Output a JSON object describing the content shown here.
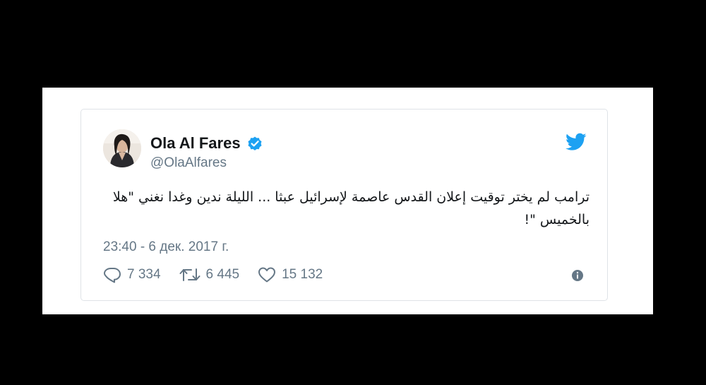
{
  "tweet": {
    "display_name": "Ola Al Fares",
    "handle": "@OlaAlfares",
    "text": "ترامب لم يختر توقيت إعلان القدس عاصمة لإسرائيل عبثا ... الليلة ندين وغدا نغني \"هلا بالخميس \"!",
    "timestamp": "23:40 - 6 дек. 2017 г.",
    "replies": "7 334",
    "retweets": "6 445",
    "likes": "15 132",
    "verified": true
  },
  "icons": {
    "verified": "verified-badge-icon",
    "brand": "twitter-bird-icon",
    "reply": "reply-icon",
    "retweet": "retweet-icon",
    "like": "heart-icon",
    "info": "info-icon"
  },
  "colors": {
    "twitter_blue": "#1da1f2",
    "text_primary": "#14171a",
    "text_secondary": "#657786",
    "card_border": "#dfe3e7",
    "background": "#000000"
  }
}
